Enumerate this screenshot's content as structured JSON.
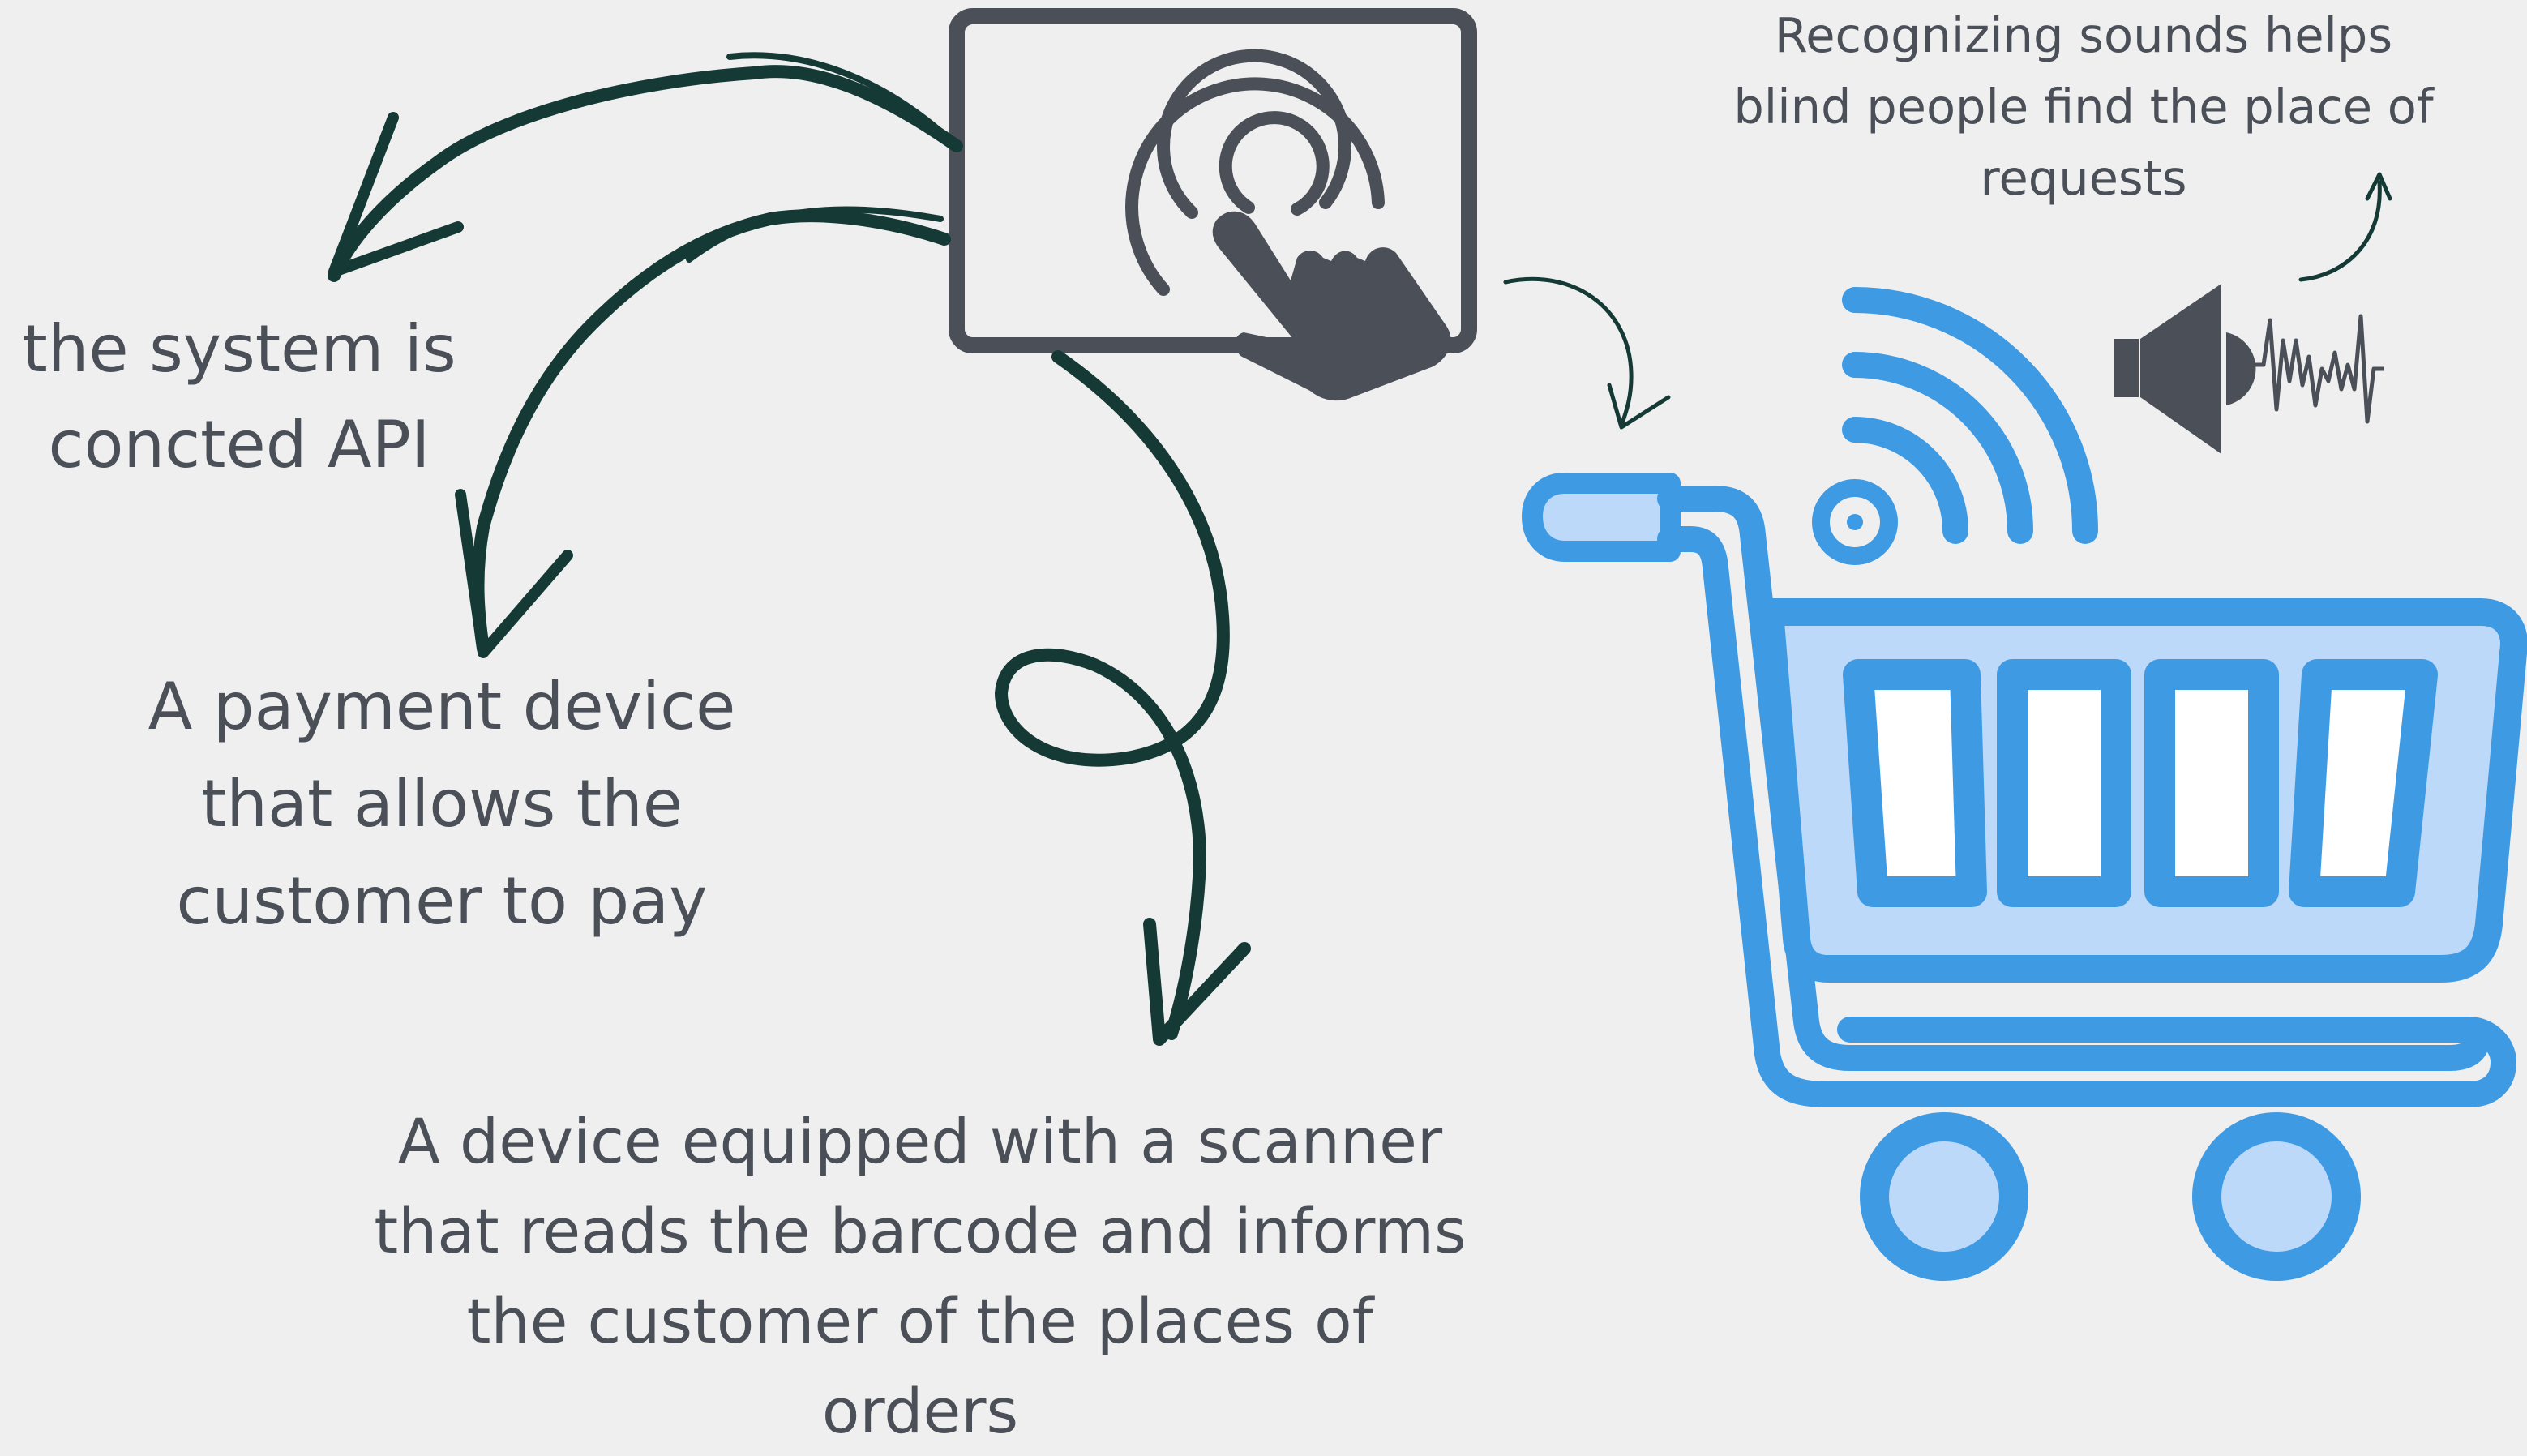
{
  "labels": {
    "api": "the system is\nconcted API",
    "payment": "A payment device\nthat allows the\ncustomer to pay",
    "scanner": "A device equipped with a scanner\nthat reads the barcode and informs\nthe customer of the places of\norders",
    "sounds": "Recognizing sounds helps\nblind people find the place of\nrequests"
  },
  "icons": {
    "touch_screen": "touch-screen-icon",
    "cart": "shopping-cart-icon",
    "wireless": "wifi-signal-icon",
    "speaker": "speaker-sound-icon"
  },
  "colors": {
    "background": "#efefef",
    "text": "#4b5058",
    "arrow": "#153a36",
    "device": "#4b4f57",
    "cart_stroke": "#3f9ae4",
    "cart_fill": "#bcd9f9"
  }
}
